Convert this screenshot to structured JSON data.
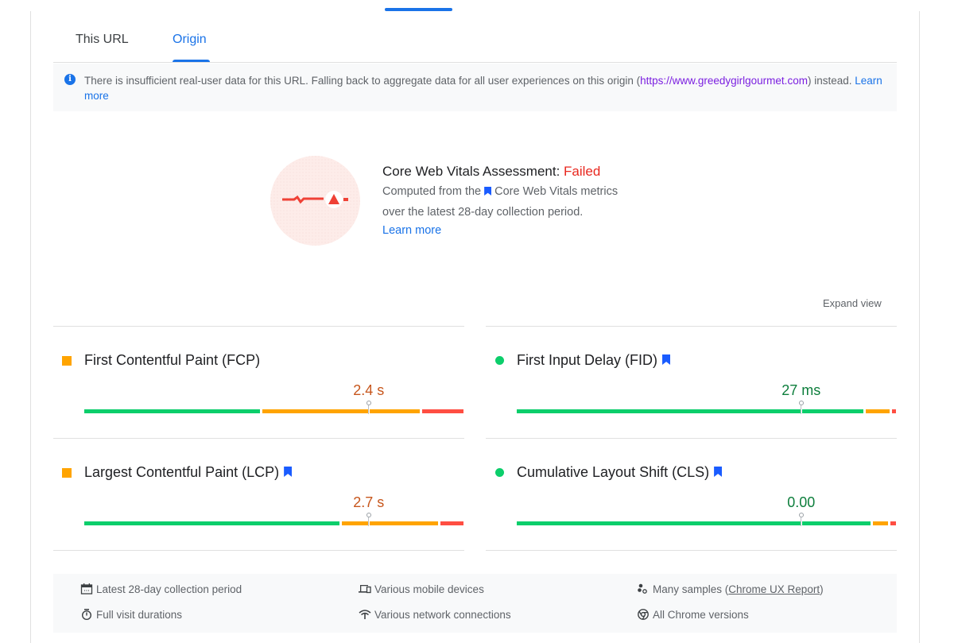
{
  "tabs": [
    {
      "label": "This URL",
      "active": false
    },
    {
      "label": "Origin",
      "active": true
    }
  ],
  "notice": {
    "icon": "info-icon",
    "text_before": "There is insufficient real-user data for this URL. Falling back to aggregate data for all user experiences on this origin (",
    "origin_link": "https://www.greedygirlgourmet.com",
    "text_after": ") instead. ",
    "learn_more": "Learn more"
  },
  "assessment": {
    "title": "Core Web Vitals Assessment: ",
    "status": "Failed",
    "desc_before": "Computed from the",
    "desc_link": "Core Web Vitals metrics",
    "desc_line2": "over the latest 28-day collection period.",
    "learn_more": "Learn more",
    "status_color": "#e8281f"
  },
  "expand_view": "Expand view",
  "metrics": [
    {
      "name": "First Contentful Paint (FCP)",
      "core": false,
      "rating": "needs-improvement",
      "value": "2.4 s",
      "distribution": {
        "good": 0.47,
        "needs_improvement": 0.42,
        "poor": 0.11
      },
      "marker_position": 0.75
    },
    {
      "name": "First Input Delay (FID)",
      "core": true,
      "rating": "good",
      "value": "27 ms",
      "distribution": {
        "good": 0.92,
        "needs_improvement": 0.07,
        "poor": 0.01
      },
      "marker_position": 0.75
    },
    {
      "name": "Largest Contentful Paint (LCP)",
      "core": true,
      "rating": "needs-improvement",
      "value": "2.7 s",
      "distribution": {
        "good": 0.68,
        "needs_improvement": 0.26,
        "poor": 0.06
      },
      "marker_position": 0.75
    },
    {
      "name": "Cumulative Layout Shift (CLS)",
      "core": true,
      "rating": "good",
      "value": "0.00",
      "distribution": {
        "good": 0.94,
        "needs_improvement": 0.045,
        "poor": 0.015
      },
      "marker_position": 0.75
    }
  ],
  "footer": {
    "items": [
      {
        "icon": "calendar-icon",
        "text": "Latest 28-day collection period"
      },
      {
        "icon": "devices-icon",
        "text": "Various mobile devices"
      },
      {
        "icon": "samples-icon",
        "text": "Many samples (",
        "link": "Chrome UX Report",
        "text_after": ")"
      },
      {
        "icon": "timer-icon",
        "text": "Full visit durations"
      },
      {
        "icon": "network-icon",
        "text": "Various network connections"
      },
      {
        "icon": "chrome-icon",
        "text": "All Chrome versions"
      }
    ]
  },
  "colors": {
    "accent": "#1a73e8",
    "good": "#0cce6b",
    "needs_improvement": "#ffa400",
    "poor": "#ff4e42"
  }
}
